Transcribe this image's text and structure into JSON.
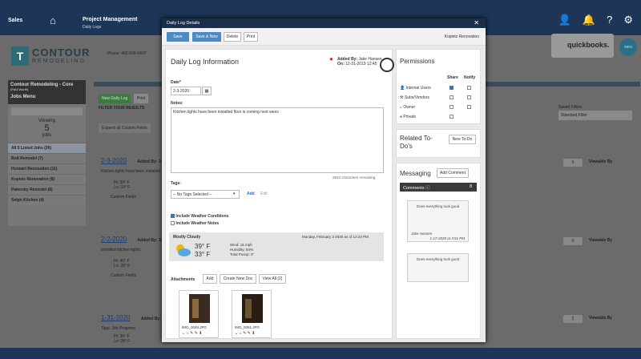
{
  "topnav": {
    "sales": "Sales",
    "project_title": "Project Management",
    "project_sub": "Daily Logs"
  },
  "logo": {
    "mark": "T",
    "line1": "CONTOUR",
    "line2": "REMODELING"
  },
  "phone": "Phone: 402-506-6407",
  "leftpanel": {
    "company": "Contour Remodeling - Core",
    "user": "(Paul Wurth)",
    "jobs_menu": "Jobs Menu",
    "viewing_label": "Viewing",
    "viewing_count": "5",
    "viewing_unit": "jobs",
    "jobs": [
      "All 5 Listed Jobs (36)",
      "Bolt Remodel (7)",
      "Horwart Renovation (11)",
      "Kopietz Renovation (8)",
      "Palensky Remodel (6)",
      "Selph Kitchen (4)"
    ]
  },
  "background": {
    "new_daily_log": "New Daily Log",
    "print": "Print",
    "filter": "FILTER YOUR RESULTS",
    "expand": "Expand all Custom Fields",
    "saved_filters": "Saved Filters",
    "saved_filter_value": "Standard Filter",
    "entries": [
      {
        "date": "2-3-2020",
        "added": "Added By: Ja",
        "note": "Kitchen lights have been installed floor is",
        "hi": "Hi: 39° F",
        "lo": "Lo: 33° F",
        "custom": "Custom Fields",
        "count": "9"
      },
      {
        "date": "2-2-2020",
        "added": "Added By: Ja",
        "note": "Installed kitchen lights.",
        "hi": "Hi: 40° F",
        "lo": "Lo: 28° F",
        "custom": "Custom Fields",
        "count": "0"
      },
      {
        "date": "1-31-2020",
        "added": "Added By: Ton",
        "note": "Tags: Job Progress",
        "hi": "Hi: 36° F",
        "lo": "Lo: 28° F",
        "custom": "",
        "count": "2"
      }
    ],
    "viewable_by": "Viewable By",
    "qb": "quickbooks.",
    "xero": "xero"
  },
  "modal": {
    "title": "Daily Log Details",
    "save": "Save",
    "save_new": "Save & New",
    "delete": "Delete",
    "print": "Print",
    "job_name": "Kopietz Renovation",
    "heading": "Daily Log Information",
    "added_by_label": "Added By:",
    "added_by": "Jake Hansen",
    "on_label": "On:",
    "on": "12-31-2019 12:45",
    "date_label": "Date*",
    "date_value": "2-3-2020",
    "notes_label": "Notes:",
    "notes_value": "Kitchen lights have been installed floor is coming next wees",
    "chars_remaining": "3940 characters remaining.",
    "tags_label": "Tags:",
    "tags_placeholder": "-- No Tags Selected --",
    "tags_add": "Add",
    "tags_edit": "Edit",
    "include_weather": "Include Weather Conditions",
    "include_weather_notes": "Include Weather Notes",
    "weather": {
      "condition": "Mostly Cloudy",
      "datetime": "Monday, February 3 2020 as of 12:23 PM",
      "high": "39° F",
      "low": "33° F",
      "wind": "Wind: 15 mph",
      "humidity": "Humidity: 84%",
      "precip": "Total Precip: 0\""
    },
    "attachments_label": "Attachments",
    "attach_add": "Add",
    "attach_new_doc": "Create New Doc",
    "attach_view_all": "View All (2)",
    "files": [
      "IMG_0048.JPG",
      "IMG_0051.JPG"
    ],
    "permissions": {
      "title": "Permissions",
      "share": "Share",
      "notify": "Notify",
      "rows": [
        {
          "label": "Internal Users",
          "share": true
        },
        {
          "label": "Subs/Vendors",
          "share": false
        },
        {
          "label": "Owner",
          "share": false
        },
        {
          "label": "Private",
          "share": false
        }
      ]
    },
    "todos": {
      "title_line1": "Related To-",
      "title_line2": "Do's",
      "new_btn": "New To-Do"
    },
    "messaging": {
      "title": "Messaging",
      "add_comment": "Add Comment",
      "comments_label": "Comments",
      "comments_count": "8",
      "note1": "Does everything look good",
      "author": "Jake Hansen",
      "author_time": "1-17-2020 at 3:51 PM",
      "note2": "Does everything look good"
    }
  }
}
